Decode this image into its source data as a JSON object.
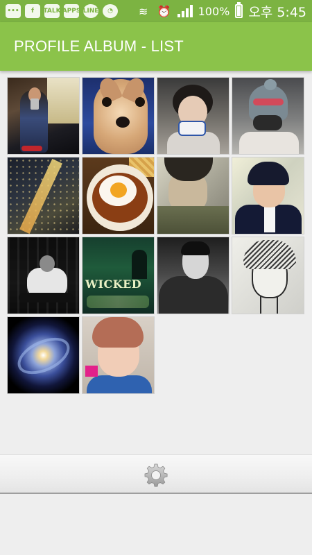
{
  "status_bar": {
    "left_icons": [
      "message-icon",
      "facebook-icon",
      "talk-icon",
      "apps-icon",
      "line-icon",
      "wechat-icon"
    ],
    "left_labels": {
      "talk": "TALK",
      "apps": "APPS",
      "line": "LINE"
    },
    "battery_text": "100%",
    "time_text": "오후 5:45"
  },
  "app_bar": {
    "title": "PROFILE ALBUM - LIST",
    "color": "#8bc34a"
  },
  "album": {
    "items": [
      {
        "subject": "selfie in mirror"
      },
      {
        "subject": "dog close-up"
      },
      {
        "subject": "girl drinking"
      },
      {
        "subject": "costume hat"
      },
      {
        "subject": "night cityscape"
      },
      {
        "subject": "fried egg hamburg steak"
      },
      {
        "subject": "man in coat"
      },
      {
        "subject": "man in suit"
      },
      {
        "subject": "black and white portrait"
      },
      {
        "subject": "wicked sign"
      },
      {
        "subject": "man in dark coat"
      },
      {
        "subject": "sketch portrait"
      },
      {
        "subject": "galaxy"
      },
      {
        "subject": "selfie pink hair"
      }
    ],
    "wicked_text": "WICKED"
  },
  "bottom_bar": {
    "settings_icon": "gear-icon"
  }
}
